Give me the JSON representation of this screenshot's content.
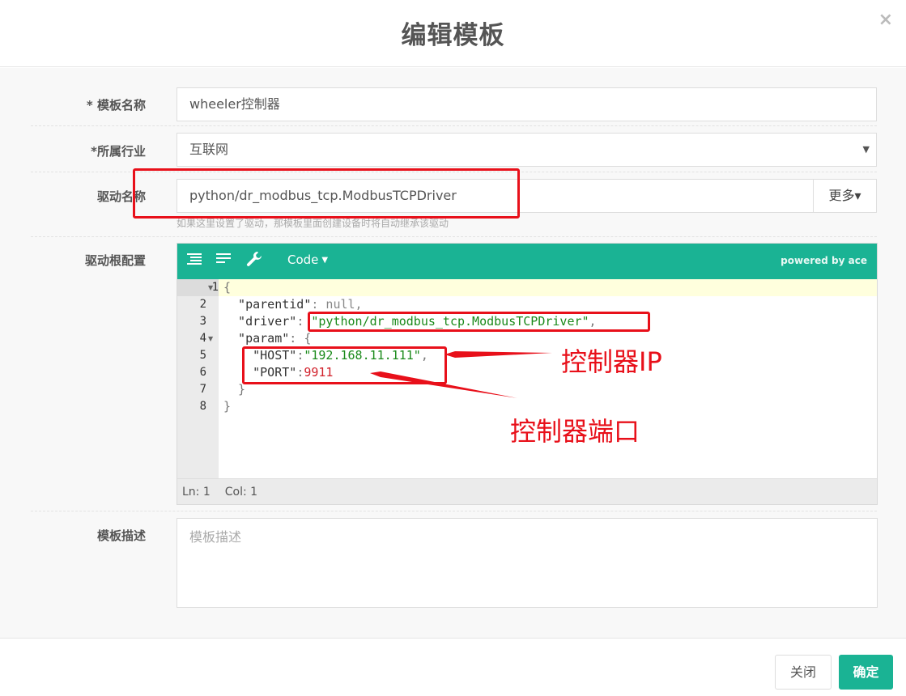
{
  "modal": {
    "title": "编辑模板",
    "close_glyph": "×"
  },
  "form": {
    "name": {
      "label": "* 模板名称",
      "value": "wheeler控制器"
    },
    "industry": {
      "label": "*所属行业",
      "value": "互联网",
      "arrow": "▼"
    },
    "driver": {
      "label": "驱动名称",
      "value": "python/dr_modbus_tcp.ModbusTCPDriver",
      "more_label": "更多",
      "more_caret": "▾",
      "help": "如果这里设置了驱动，那模板里面创建设备时将自动继承该驱动"
    },
    "config": {
      "label": "驱动根配置",
      "toolbar": {
        "mode_label": "Code",
        "mode_caret": "▼",
        "powered": "powered by ace"
      },
      "lines": [
        {
          "num": "1",
          "fold": "▼"
        },
        {
          "num": "2",
          "fold": ""
        },
        {
          "num": "3",
          "fold": ""
        },
        {
          "num": "4",
          "fold": "▼"
        },
        {
          "num": "5",
          "fold": ""
        },
        {
          "num": "6",
          "fold": ""
        },
        {
          "num": "7",
          "fold": ""
        },
        {
          "num": "8",
          "fold": ""
        }
      ],
      "code": {
        "l1": "{",
        "l2_key": "  \"parentid\"",
        "l2_rest": ": null,",
        "l3_key": "  \"driver\"",
        "l3_colon": ": ",
        "l3_val": "\"python/dr_modbus_tcp.ModbusTCPDriver\"",
        "l3_comma": ",",
        "l4_key": "  \"param\"",
        "l4_rest": ": {",
        "l5_key": "    \"HOST\"",
        "l5_colon": ":",
        "l5_val": "\"192.168.11.111\"",
        "l5_comma": ",",
        "l6_key": "    \"PORT\"",
        "l6_colon": ":",
        "l6_val": "9911",
        "l7": "  }",
        "l8": "}"
      },
      "status": {
        "ln": "Ln: 1",
        "col": "Col: 1"
      }
    },
    "description": {
      "label": "模板描述",
      "placeholder": "模板描述"
    }
  },
  "footer": {
    "close_label": "关闭",
    "confirm_label": "确定"
  },
  "annotations": {
    "host_label": "控制器IP",
    "port_label": "控制器端口",
    "color": "#e8101a"
  },
  "colors": {
    "accent": "#1ab394"
  }
}
